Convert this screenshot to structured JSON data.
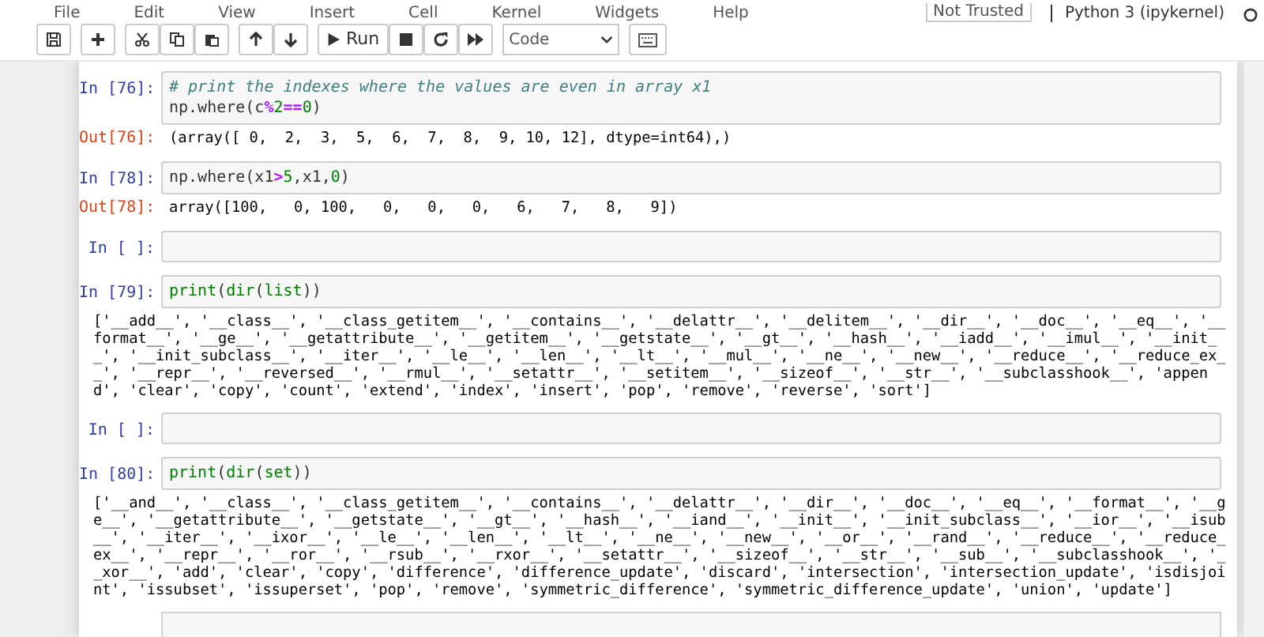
{
  "menu": [
    "File",
    "Edit",
    "View",
    "Insert",
    "Cell",
    "Kernel",
    "Widgets",
    "Help"
  ],
  "trusted_label": "Not Trusted",
  "kernel_label": "Python 3 (ipykernel)",
  "toolbar": {
    "run_label": "Run",
    "cell_type": "Code"
  },
  "cells": [
    {
      "prompt": "In [76]:",
      "code": [
        [
          {
            "t": "# print the indexes where the values are even in array x1",
            "kind": "comment"
          }
        ],
        [
          {
            "t": "np.where(c",
            "kind": "plain"
          },
          {
            "t": "%",
            "kind": "op"
          },
          {
            "t": "2",
            "kind": "num"
          },
          {
            "t": "==",
            "kind": "op"
          },
          {
            "t": "0",
            "kind": "num"
          },
          {
            "t": ")",
            "kind": "plain"
          }
        ]
      ],
      "out_prompt": "Out[76]:",
      "output": [
        "(array([ 0,  2,  3,  5,  6,  7,  8,  9, 10, 12], dtype=int64),)"
      ]
    },
    {
      "prompt": "In [78]:",
      "code": [
        [
          {
            "t": "np.where(x1",
            "kind": "plain"
          },
          {
            "t": ">",
            "kind": "op"
          },
          {
            "t": "5",
            "kind": "num"
          },
          {
            "t": ",x1,",
            "kind": "plain"
          },
          {
            "t": "0",
            "kind": "num"
          },
          {
            "t": ")",
            "kind": "plain"
          }
        ]
      ],
      "out_prompt": "Out[78]:",
      "output": [
        "array([100,   0, 100,   0,   0,   0,   6,   7,   8,   9])"
      ]
    },
    {
      "prompt": "In [ ]:"
    },
    {
      "prompt": "In [79]:",
      "code": [
        [
          {
            "t": "print",
            "kind": "builtin"
          },
          {
            "t": "(",
            "kind": "plain"
          },
          {
            "t": "dir",
            "kind": "builtin"
          },
          {
            "t": "(",
            "kind": "plain"
          },
          {
            "t": "list",
            "kind": "builtin"
          },
          {
            "t": "))",
            "kind": "plain"
          }
        ]
      ],
      "output": [
        "['__add__', '__class__', '__class_getitem__', '__contains__', '__delattr__', '__delitem__', '__dir__', '__doc__', '__eq__', '__",
        "format__', '__ge__', '__getattribute__', '__getitem__', '__getstate__', '__gt__', '__hash__', '__iadd__', '__imul__', '__init_",
        "_', '__init_subclass__', '__iter__', '__le__', '__len__', '__lt__', '__mul__', '__ne__', '__new__', '__reduce__', '__reduce_ex_",
        "_', '__repr__', '__reversed__', '__rmul__', '__setattr__', '__setitem__', '__sizeof__', '__str__', '__subclasshook__', 'appen",
        "d', 'clear', 'copy', 'count', 'extend', 'index', 'insert', 'pop', 'remove', 'reverse', 'sort']"
      ]
    },
    {
      "prompt": "In [ ]:"
    },
    {
      "prompt": "In [80]:",
      "code": [
        [
          {
            "t": "print",
            "kind": "builtin"
          },
          {
            "t": "(",
            "kind": "plain"
          },
          {
            "t": "dir",
            "kind": "builtin"
          },
          {
            "t": "(",
            "kind": "plain"
          },
          {
            "t": "set",
            "kind": "builtin"
          },
          {
            "t": "))",
            "kind": "plain"
          }
        ]
      ],
      "output": [
        "['__and__', '__class__', '__class_getitem__', '__contains__', '__delattr__', '__dir__', '__doc__', '__eq__', '__format__', '__g",
        "e__', '__getattribute__', '__getstate__', '__gt__', '__hash__', '__iand__', '__init__', '__init_subclass__', '__ior__', '__isub",
        "__', '__iter__', '__ixor__', '__le__', '__len__', '__lt__', '__ne__', '__new__', '__or__', '__rand__', '__reduce__', '__reduce_",
        "ex__', '__repr__', '__ror__', '__rsub__', '__rxor__', '__setattr__', '__sizeof__', '__str__', '__sub__', '__subclasshook__', '_",
        "_xor__', 'add', 'clear', 'copy', 'difference', 'difference_update', 'discard', 'intersection', 'intersection_update', 'isdisjoi",
        "nt', 'issubset', 'issuperset', 'pop', 'remove', 'symmetric_difference', 'symmetric_difference_update', 'union', 'update']"
      ]
    }
  ]
}
